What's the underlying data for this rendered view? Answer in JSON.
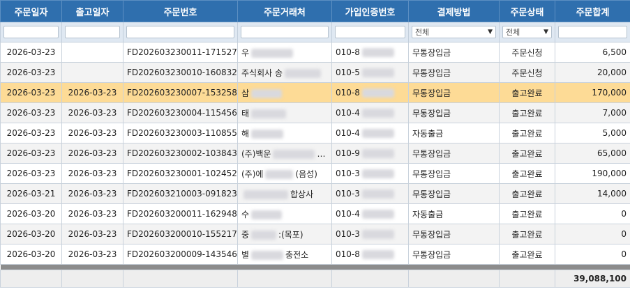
{
  "headers": [
    "주문일자",
    "출고일자",
    "주문번호",
    "주문거래처",
    "가입인증번호",
    "결제방법",
    "주문상태",
    "주문합계"
  ],
  "filters": {
    "payment": "전체",
    "status": "전체"
  },
  "rows": [
    {
      "order_date": "2026-03-23",
      "ship_date": "",
      "order_no": "FD202603230011-171527",
      "client_pre": "우",
      "client_post": "",
      "cert": "010-8",
      "payment": "무통장입금",
      "status": "주문신청",
      "total": "6,500"
    },
    {
      "order_date": "2026-03-23",
      "ship_date": "",
      "order_no": "FD202603230010-160832",
      "client_pre": "주식회사 송",
      "client_post": "",
      "cert": "010-5",
      "payment": "무통장입금",
      "status": "주문신청",
      "total": "20,000"
    },
    {
      "order_date": "2026-03-23",
      "ship_date": "2026-03-23",
      "order_no": "FD202603230007-153258",
      "client_pre": "삼",
      "client_post": "",
      "cert": "010-8",
      "payment": "무통장입금",
      "status": "출고완료",
      "total": "170,000"
    },
    {
      "order_date": "2026-03-23",
      "ship_date": "2026-03-23",
      "order_no": "FD202603230004-115456",
      "client_pre": "태",
      "client_post": "",
      "cert": "010-4",
      "payment": "무통장입금",
      "status": "출고완료",
      "total": "7,000"
    },
    {
      "order_date": "2026-03-23",
      "ship_date": "2026-03-23",
      "order_no": "FD202603230003-110855",
      "client_pre": "해",
      "client_post": "",
      "cert": "010-4",
      "payment": "자동출금",
      "status": "출고완료",
      "total": "5,000"
    },
    {
      "order_date": "2026-03-23",
      "ship_date": "2026-03-23",
      "order_no": "FD202603230002-103843",
      "client_pre": "(주)백운",
      "client_post": "…",
      "cert": "010-9",
      "payment": "무통장입금",
      "status": "출고완료",
      "total": "65,000"
    },
    {
      "order_date": "2026-03-23",
      "ship_date": "2026-03-23",
      "order_no": "FD202603230001-102452",
      "client_pre": "(주)에",
      "client_post": "(음성)",
      "cert": "010-3",
      "payment": "무통장입금",
      "status": "출고완료",
      "total": "190,000"
    },
    {
      "order_date": "2026-03-21",
      "ship_date": "2026-03-23",
      "order_no": "FD202603210003-091823",
      "client_pre": "",
      "client_post": "합상사",
      "cert": "010-3",
      "payment": "무통장입금",
      "status": "출고완료",
      "total": "14,000"
    },
    {
      "order_date": "2026-03-20",
      "ship_date": "2026-03-23",
      "order_no": "FD202603200011-162948",
      "client_pre": "수",
      "client_post": "",
      "cert": "010-4",
      "payment": "자동출금",
      "status": "출고완료",
      "total": "0"
    },
    {
      "order_date": "2026-03-20",
      "ship_date": "2026-03-23",
      "order_no": "FD202603200010-155217",
      "client_pre": "중",
      "client_post": ":(목포)",
      "cert": "010-3",
      "payment": "무통장입금",
      "status": "출고완료",
      "total": "0"
    },
    {
      "order_date": "2026-03-20",
      "ship_date": "2026-03-23",
      "order_no": "FD202603200009-143546",
      "client_pre": "별",
      "client_post": "충전소",
      "cert": "010-8",
      "payment": "무통장입금",
      "status": "출고완료",
      "total": "0"
    }
  ],
  "selected_row": 2,
  "grand_total": "39,088,100"
}
